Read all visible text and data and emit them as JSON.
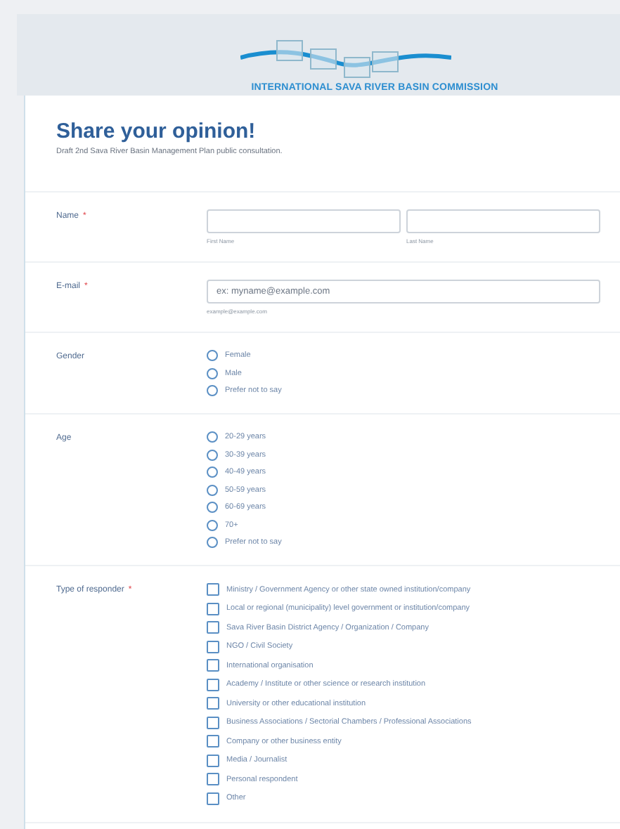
{
  "header": {
    "logo_text": "INTERNATIONAL SAVA RIVER BASIN COMMISSION"
  },
  "form": {
    "title": "Share your opinion!",
    "subtitle": "Draft 2nd Sava River Basin Management Plan public consultation.",
    "fields": [
      {
        "kind": "name",
        "label": "Name",
        "required_mark": "*",
        "inputs": [
          {
            "sublabel": "First Name"
          },
          {
            "sublabel": "Last Name"
          }
        ]
      },
      {
        "kind": "email",
        "label": "E-mail",
        "required_mark": "*",
        "placeholder": "ex: myname@example.com",
        "sublabel": "example@example.com"
      },
      {
        "kind": "radio",
        "label": "Gender",
        "options": [
          {
            "label": "Female",
            "selected": false
          },
          {
            "label": "Male",
            "selected": false
          },
          {
            "label": "Prefer not to say",
            "selected": false
          }
        ]
      },
      {
        "kind": "radio",
        "label": "Age",
        "options": [
          {
            "label": "20-29 years",
            "selected": false
          },
          {
            "label": "30-39 years",
            "selected": false
          },
          {
            "label": "40-49 years",
            "selected": false
          },
          {
            "label": "50-59 years",
            "selected": false
          },
          {
            "label": "60-69 years",
            "selected": false
          },
          {
            "label": "70+",
            "selected": false
          },
          {
            "label": "Prefer not to say",
            "selected": false
          }
        ]
      },
      {
        "kind": "checkbox",
        "label": "Type of responder",
        "required_mark": "*",
        "options": [
          {
            "label": "Ministry / Government Agency or other state owned institution/company",
            "checked": false
          },
          {
            "label": "Local or regional (municipality) level government or institution/company",
            "checked": false
          },
          {
            "label": "Sava River Basin District Agency / Organization / Company",
            "checked": false
          },
          {
            "label": "NGO / Civil Society",
            "checked": false
          },
          {
            "label": "International organisation",
            "checked": false
          },
          {
            "label": "Academy / Institute or other science or research institution",
            "checked": false
          },
          {
            "label": "University or other educational institution",
            "checked": false
          },
          {
            "label": "Business Associations / Sectorial Chambers / Professional Associations",
            "checked": false
          },
          {
            "label": "Company or other business entity",
            "checked": false
          },
          {
            "label": "Media / Journalist",
            "checked": false
          },
          {
            "label": "Personal respondent",
            "checked": false
          },
          {
            "label": "Other",
            "checked": false
          }
        ]
      }
    ]
  }
}
